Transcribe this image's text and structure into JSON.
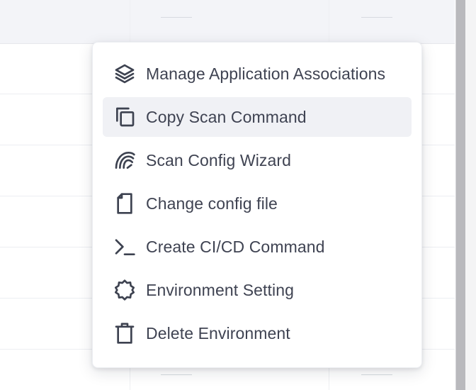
{
  "menu": {
    "items": [
      {
        "label": "Manage Application Associations",
        "icon": "layers-icon"
      },
      {
        "label": "Copy Scan Command",
        "icon": "copy-icon",
        "highlighted": true
      },
      {
        "label": "Scan Config Wizard",
        "icon": "wizard-arc-icon"
      },
      {
        "label": "Change config file",
        "icon": "file-icon"
      },
      {
        "label": "Create CI/CD Command",
        "icon": "terminal-icon"
      },
      {
        "label": "Environment Setting",
        "icon": "gear-icon"
      },
      {
        "label": "Delete Environment",
        "icon": "trash-icon"
      }
    ]
  },
  "colors": {
    "menu_text": "#3f4352",
    "icon_stroke": "#3d4250",
    "highlight_bg": "#f0f1f5",
    "header_bg": "#f3f4f8"
  }
}
